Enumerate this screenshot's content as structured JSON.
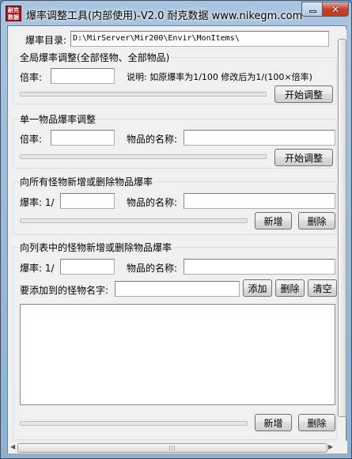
{
  "window": {
    "title": "爆率调整工具(内部使用)-V2.0  耐克数据 www.nikegm.com",
    "icon_text": "耐克\n数据"
  },
  "dir": {
    "label": "爆率目录:",
    "value": "D:\\MirServer\\Mir200\\Envir\\MonItems\\"
  },
  "global": {
    "title": "全局爆率调整(全部怪物、全部物品)",
    "rate_label": "倍率:",
    "rate_value": "",
    "note": "说明: 如原爆率为1/100  修改后为1/(100×倍率)",
    "button": "开始调整",
    "progress": 0
  },
  "single": {
    "title": "单一物品爆率调整",
    "rate_label": "倍率:",
    "rate_value": "",
    "item_label": "物品的名称:",
    "item_value": "",
    "button": "开始调整",
    "progress": 0
  },
  "all_monsters": {
    "title": "向所有怪物新增或删除物品爆率",
    "rate_label": "爆率: 1/",
    "rate_value": "",
    "item_label": "物品的名称:",
    "item_value": "",
    "add_button": "新增",
    "delete_button": "删除",
    "progress": 0
  },
  "list_monsters": {
    "title": "向列表中的怪物新增或删除物品爆率",
    "rate_label": "爆率: 1/",
    "rate_value": "",
    "item_label": "物品的名称:",
    "item_value": "",
    "monster_label": "要添加到的怪物名字:",
    "monster_value": "",
    "add_name_button": "添加",
    "delete_name_button": "删除",
    "clear_button": "清空",
    "monsters": [],
    "add_button": "新增",
    "delete_button": "删除",
    "progress": 0
  },
  "icons": {
    "minimize": "minimize-icon",
    "close": "close-icon",
    "scroll_left": "arrow-left-icon",
    "scroll_right": "arrow-right-icon",
    "grip": "grip-icon"
  },
  "colors": {
    "titlebar": "#a9c4de",
    "close_button": "#c6422a",
    "client_bg": "#f0f0f0"
  }
}
